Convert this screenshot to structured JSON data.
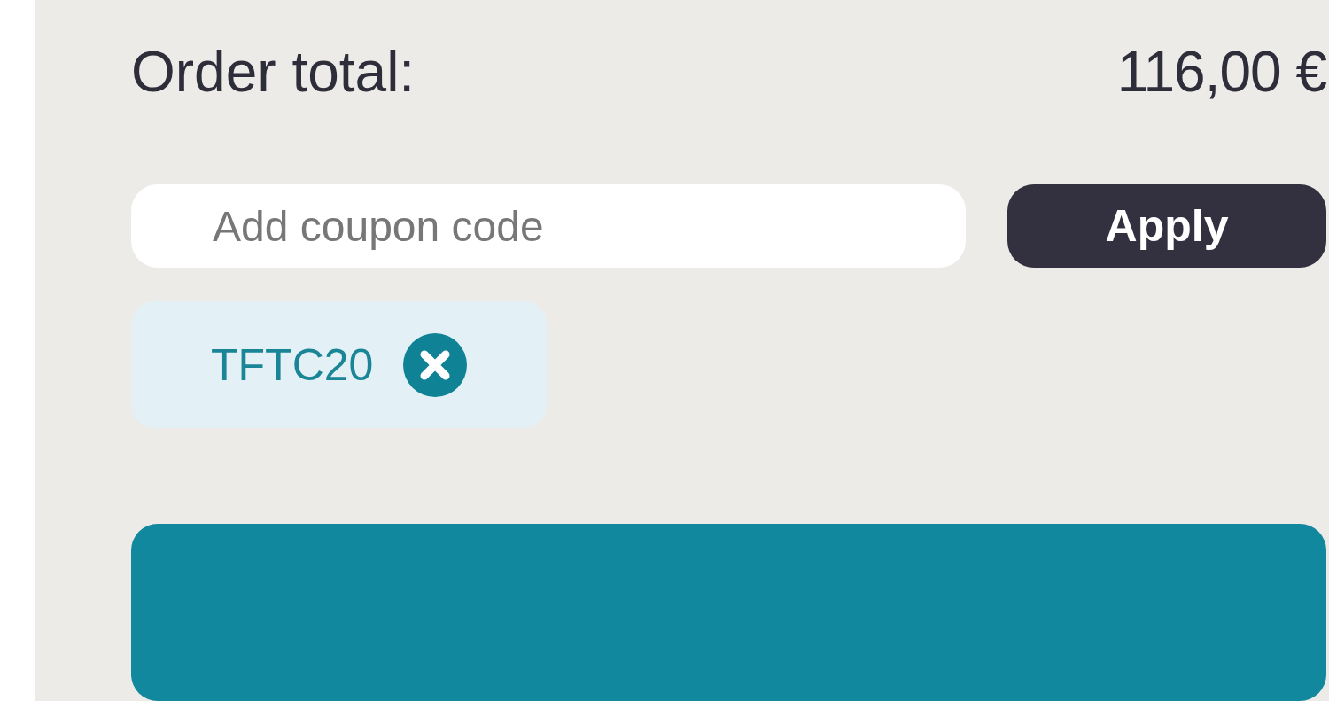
{
  "summary": {
    "label": "Order total:",
    "amount": "116,00 €"
  },
  "coupon": {
    "placeholder": "Add coupon code",
    "button": "Apply"
  },
  "applied_coupons": [
    {
      "code": "TFTC20"
    }
  ]
}
